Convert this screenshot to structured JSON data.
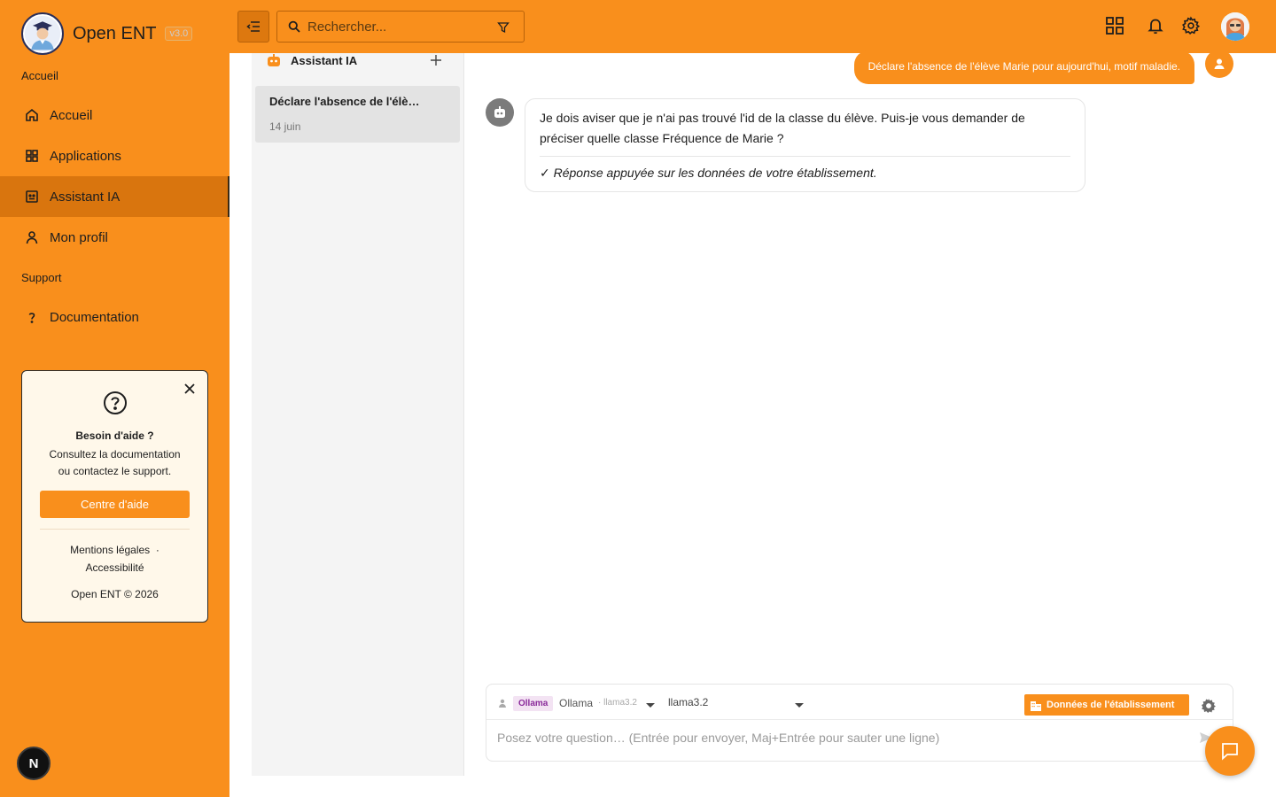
{
  "sidebar": {
    "brand_name": "Open ENT",
    "version": "v3.0",
    "section_home": "Accueil",
    "section_support": "Support",
    "items": [
      {
        "label": "Accueil",
        "icon": "home-icon"
      },
      {
        "label": "Applications",
        "icon": "grid-icon"
      },
      {
        "label": "Assistant IA",
        "icon": "assistant-icon",
        "active": true
      },
      {
        "label": "Mon profil",
        "icon": "user-icon"
      },
      {
        "label": "Documentation",
        "icon": "question-icon"
      }
    ],
    "help": {
      "title": "Besoin d'aide ?",
      "line1": "Consultez la documentation",
      "line2": "ou contactez le support.",
      "button": "Centre d'aide",
      "link_legal": "Mentions légales",
      "separator": "·",
      "link_access": "Accessibilité",
      "copyright": "Open ENT © 2026"
    },
    "n_badge": "N"
  },
  "topbar": {
    "search_placeholder": "Rechercher..."
  },
  "conversations": {
    "title": "Assistant IA",
    "items": [
      {
        "title": "Déclare l'absence de l'élè…",
        "date": "14 juin"
      }
    ]
  },
  "chat": {
    "user_message": "Déclare l'absence de l'élève Marie pour aujourd'hui, motif maladie.",
    "bot_message": "Je dois aviser que je n'ai pas trouvé l'id de la classe du élève. Puis-je vous demander de préciser quelle classe Fréquence de Marie ?",
    "bot_note": "✓ Réponse appuyée sur les données de votre établissement."
  },
  "composer": {
    "provider_badge": "Ollama",
    "provider_name": "Ollama",
    "provider_model": "· llama3.2",
    "model_select": "llama3.2",
    "data_button": "Données de l'établissement",
    "placeholder": "Posez votre question… (Entrée pour envoyer, Maj+Entrée pour sauter une ligne)"
  },
  "colors": {
    "accent": "#f98f1c",
    "accent_dark": "#d9750e",
    "help_bg": "#fff8ea",
    "bot_avatar": "#7b7b7b"
  }
}
